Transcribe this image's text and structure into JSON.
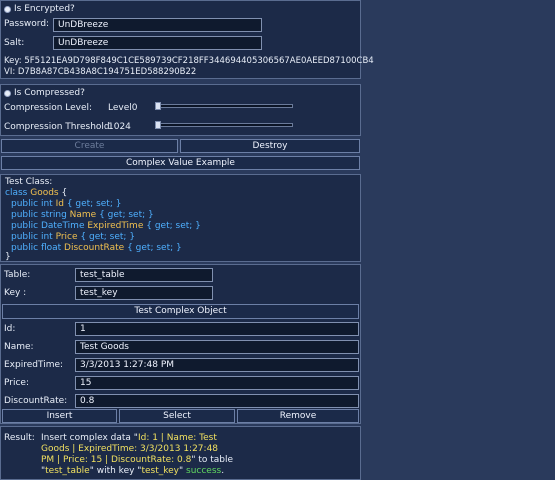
{
  "encryption": {
    "toggle_label": "Is Encrypted?",
    "password_label": "Password:",
    "password_value": "UnDBreeze",
    "salt_label": "Salt:",
    "salt_value": "UnDBreeze",
    "key_line": "Key: 5F5121EA9D798F849C1CE589739CF218FF344694405306567AE0AEED87100CB4",
    "vi_line": "VI: D7B8A87CB438A8C194751ED588290B22"
  },
  "compression": {
    "toggle_label": "Is Compressed?",
    "level_label": "Compression Level:",
    "level_value": "Level0",
    "threshold_label": "Compression Threshold:",
    "threshold_value": "1024"
  },
  "actions": {
    "create_label": "Create",
    "destroy_label": "Destroy"
  },
  "complex_header": "Complex Value Example",
  "test_class": {
    "title": "Test Class:",
    "decl_kw": "class",
    "decl_name": "Goods",
    "open_brace": "{",
    "close_brace": "}",
    "props": [
      {
        "mods": "public int",
        "name": "Id",
        "acc": "{ get; set; }"
      },
      {
        "mods": "public string",
        "name": "Name",
        "acc": "{ get; set; }"
      },
      {
        "mods": "public DateTime",
        "name": "ExpiredTime",
        "acc": "{ get; set; }"
      },
      {
        "mods": "public int",
        "name": "Price",
        "acc": "{ get; set; }"
      },
      {
        "mods": "public float",
        "name": "DiscountRate",
        "acc": "{ get; set; }"
      }
    ]
  },
  "table": {
    "table_label": "Table:",
    "table_value": "test_table",
    "key_label": "Key :",
    "key_value": "test_key",
    "test_button": "Test Complex Object"
  },
  "object": {
    "id_label": "Id:",
    "id_value": "1",
    "name_label": "Name:",
    "name_value": "Test Goods",
    "expired_label": "ExpiredTime:",
    "expired_value": "3/3/2013 1:27:48 PM",
    "price_label": "Price:",
    "price_value": "15",
    "discount_label": "DiscountRate:",
    "discount_value": "0.8"
  },
  "ops": {
    "insert_label": "Insert",
    "select_label": "Select",
    "remove_label": "Remove"
  },
  "result": {
    "label": "Result:",
    "line1_a": "Insert complex data \"",
    "line1_b": "Id: 1 | Name: Test",
    "line2": "Goods | ExpiredTime: 3/3/2013 1:27:48",
    "line3_a": "PM | Price: 15 | DiscountRate: 0.8",
    "line3_b": "\" to table",
    "line4_a": "\"",
    "line4_b": "test_table",
    "line4_c": "\" with key \"",
    "line4_d": "test_key",
    "line4_e": "\" ",
    "line4_f": "success",
    "line4_g": "."
  }
}
